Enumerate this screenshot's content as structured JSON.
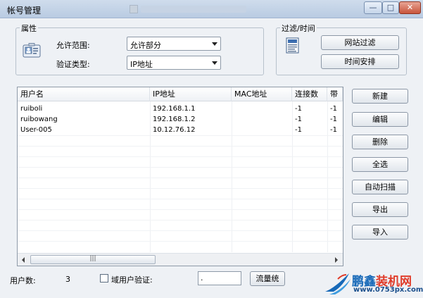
{
  "window": {
    "title": "帐号管理",
    "controls": {
      "minimize": "—",
      "maximize": "□",
      "close": "✕"
    }
  },
  "properties": {
    "legend": "属性",
    "allow_scope_label": "允许范围:",
    "allow_scope_value": "允许部分",
    "verify_type_label": "验证类型:",
    "verify_type_value": "IP地址"
  },
  "filter": {
    "legend": "过滤/时间",
    "site_filter_button": "网站过滤",
    "time_schedule_button": "时间安排"
  },
  "table": {
    "columns": [
      "用户名",
      "IP地址",
      "MAC地址",
      "连接数",
      "带"
    ],
    "rows": [
      [
        "ruiboli",
        "192.168.1.1",
        "",
        "-1",
        "-1"
      ],
      [
        "ruibowang",
        "192.168.1.2",
        "",
        "-1",
        "-1"
      ],
      [
        "User-005",
        "10.12.76.12",
        "",
        "-1",
        "-1"
      ]
    ],
    "scroll_thumb_grip": "|||"
  },
  "actions": {
    "new": "新建",
    "edit": "编辑",
    "delete": "删除",
    "select_all": "全选",
    "auto_scan": "自动扫描",
    "export": "导出",
    "import": "导入"
  },
  "footer": {
    "user_count_label": "用户数:",
    "user_count_value": "3",
    "domain_verify_label": "域用户验证:",
    "domain_field_value": ".",
    "traffic_stats_button": "流量统"
  },
  "watermark": {
    "brand_part1": "鹏鑫",
    "brand_part2": "装机网",
    "url": "www.0753px.com"
  },
  "icons": [
    "properties-icon",
    "document-icon",
    "chevron-down-icon",
    "scroll-left-icon",
    "scroll-right-icon",
    "bird-logo-icon"
  ]
}
